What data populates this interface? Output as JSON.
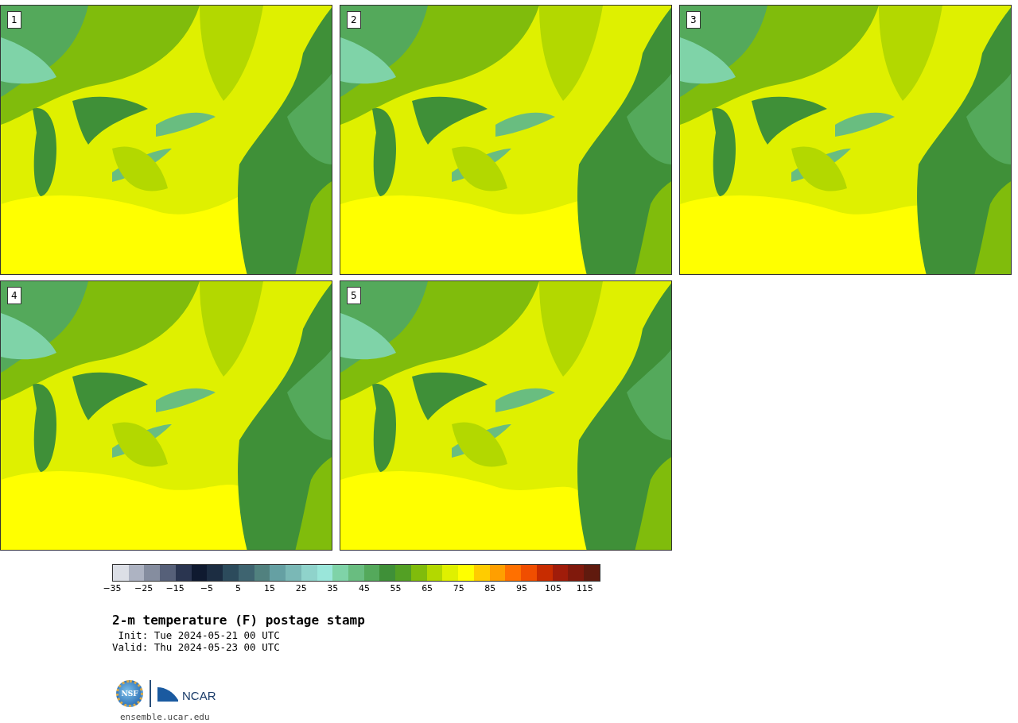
{
  "stamps": [
    {
      "label": "1"
    },
    {
      "label": "2"
    },
    {
      "label": "3"
    },
    {
      "label": "4"
    },
    {
      "label": "5"
    }
  ],
  "colorbar": {
    "swatches": [
      {
        "color": "#dcdfe6"
      },
      {
        "color": "#adb3c2"
      },
      {
        "color": "#858d9f"
      },
      {
        "color": "#566079"
      },
      {
        "color": "#2a3550"
      },
      {
        "color": "#0f1a30"
      },
      {
        "color": "#1c2d42"
      },
      {
        "color": "#2c4b5c"
      },
      {
        "color": "#3e6470"
      },
      {
        "color": "#51817f"
      },
      {
        "color": "#65a0a3"
      },
      {
        "color": "#7ab8b6"
      },
      {
        "color": "#8fd3cb"
      },
      {
        "color": "#9ae6da"
      },
      {
        "color": "#7fd3a8"
      },
      {
        "color": "#69bd80"
      },
      {
        "color": "#54a95b"
      },
      {
        "color": "#3f9038"
      },
      {
        "color": "#53a024"
      },
      {
        "color": "#80bc0c"
      },
      {
        "color": "#b3d800"
      },
      {
        "color": "#dff000"
      },
      {
        "color": "#ffff00"
      },
      {
        "color": "#ffcc00"
      },
      {
        "color": "#ff9f00"
      },
      {
        "color": "#ff7000"
      },
      {
        "color": "#f04e00"
      },
      {
        "color": "#c82c00"
      },
      {
        "color": "#a01c0a"
      },
      {
        "color": "#80190c"
      },
      {
        "color": "#601a0e"
      }
    ],
    "ticks": [
      "−35",
      "−25",
      "−15",
      "−5",
      "5",
      "15",
      "25",
      "35",
      "45",
      "55",
      "65",
      "75",
      "85",
      "95",
      "105",
      "115"
    ]
  },
  "title": "2-m temperature (F) postage stamp",
  "init": " Init: Tue 2024-05-21 00 UTC",
  "valid": "Valid: Thu 2024-05-23 00 UTC",
  "logo": {
    "seal": "NSF",
    "wordmark": "NCAR"
  },
  "url": "ensemble.ucar.edu"
}
